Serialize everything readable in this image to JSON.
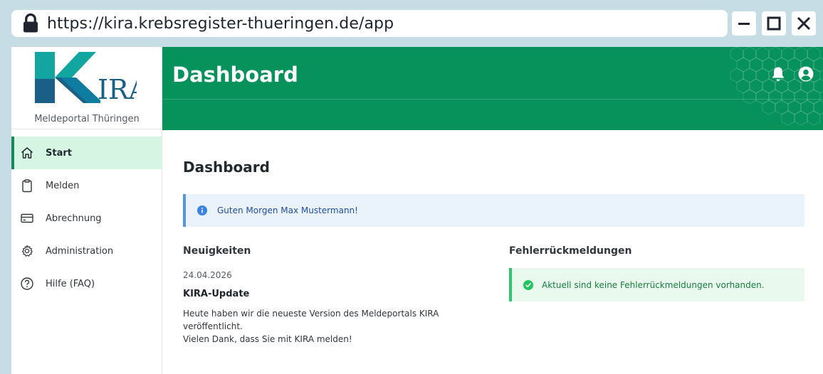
{
  "browser": {
    "url": "https://kira.krebsregister-thueringen.de/app"
  },
  "sidebar": {
    "logo_subtitle": "Meldeportal Thüringen",
    "items": [
      {
        "label": "Start",
        "icon": "home-icon",
        "active": true
      },
      {
        "label": "Melden",
        "icon": "clipboard-icon",
        "active": false
      },
      {
        "label": "Abrechnung",
        "icon": "credit-card-icon",
        "active": false
      },
      {
        "label": "Administration",
        "icon": "gear-icon",
        "active": false
      },
      {
        "label": "Hilfe (FAQ)",
        "icon": "question-circle-icon",
        "active": false
      }
    ]
  },
  "header": {
    "title": "Dashboard"
  },
  "main": {
    "title": "Dashboard",
    "greeting": "Guten Morgen Max Mustermann!",
    "news": {
      "section_title": "Neuigkeiten",
      "date": "24.04.2026",
      "heading": "KIRA-Update",
      "body_line1": "Heute haben wir die neueste Version des Meldeportals KIRA veröffentlicht.",
      "body_line2": "Vielen Dank, dass Sie mit KIRA melden!"
    },
    "errors": {
      "section_title": "Fehlerrückmeldungen",
      "message": "Aktuell sind keine Fehlerrückmeldungen vorhanden."
    }
  },
  "colors": {
    "brand_green": "#07925c",
    "active_nav_bg": "#d6f5e3",
    "info_bg": "#eaf2fc",
    "info_accent": "#5496e4",
    "success_bg": "#eaf9ee",
    "success_accent": "#2ec86b"
  }
}
